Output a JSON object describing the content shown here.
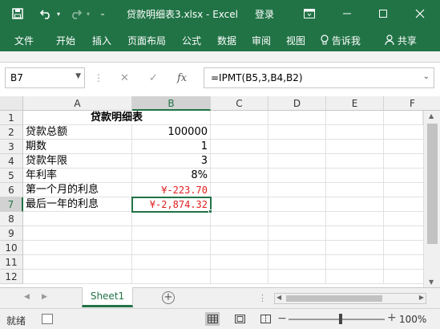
{
  "titlebar": {
    "title": "贷款明细表3.xlsx  -  Excel",
    "login": "登录"
  },
  "ribbon": {
    "tabs": [
      "文件",
      "开始",
      "插入",
      "页面布局",
      "公式",
      "数据",
      "审阅",
      "视图"
    ],
    "tell_me": "告诉我",
    "share": "共享"
  },
  "formula_bar": {
    "name_box": "B7",
    "formula": "=IPMT(B5,3,B4,B2)",
    "fx": "fx"
  },
  "grid": {
    "columns": [
      "A",
      "B",
      "C",
      "D",
      "E",
      "F"
    ],
    "selected_column": "B",
    "rows": [
      "1",
      "2",
      "3",
      "4",
      "5",
      "6",
      "7",
      "8",
      "9",
      "10",
      "11",
      "12"
    ],
    "selected_row": "7",
    "cells": {
      "A1": "贷款明细表",
      "A2": "贷款总额",
      "B2": "100000",
      "A3": "期数",
      "B3": "1",
      "A4": "贷款年限",
      "B4": "3",
      "A5": "年利率",
      "B5": "8%",
      "A6": "第一个月的利息",
      "B6": "¥-223.70",
      "A7": "最后一年的利息",
      "B7": "¥-2,874.32"
    },
    "negative_color": "#e02020"
  },
  "sheets": {
    "tabs": [
      "Sheet1"
    ],
    "active": "Sheet1",
    "add_label": "+"
  },
  "status": {
    "ready": "就绪",
    "zoom": "100%"
  },
  "colors": {
    "accent": "#217346"
  }
}
